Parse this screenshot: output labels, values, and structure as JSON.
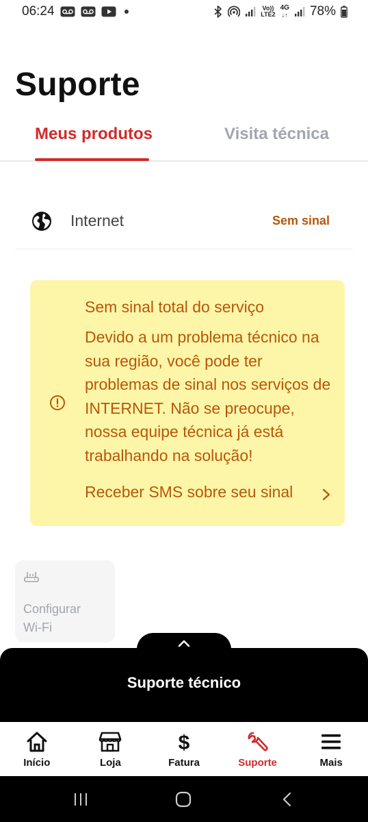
{
  "status_bar": {
    "time": "06:24",
    "battery": "78%",
    "network_vo": "Vo))",
    "network_lte": "LTE2",
    "network_4g": "4G"
  },
  "header": {
    "title": "Suporte"
  },
  "tabs": [
    {
      "label": "Meus produtos",
      "active": true
    },
    {
      "label": "Visita técnica",
      "active": false
    }
  ],
  "product": {
    "name": "Internet",
    "status": "Sem sinal"
  },
  "alert": {
    "title": "Sem sinal total do serviço",
    "message": "Devido a um problema técnico na sua região, você pode ter problemas de sinal nos serviços de INTERNET. Não se preocupe, nossa equipe técnica já está trabalhando na solução!",
    "link": "Receber SMS sobre seu sinal"
  },
  "wifi_tile": {
    "label": "Configurar\nWi-Fi"
  },
  "sheet": {
    "title": "Suporte técnico"
  },
  "bottom_nav": [
    {
      "label": "Início",
      "icon": "home-icon"
    },
    {
      "label": "Loja",
      "icon": "store-icon"
    },
    {
      "label": "Fatura",
      "icon": "dollar-icon"
    },
    {
      "label": "Suporte",
      "icon": "wrench-icon",
      "active": true
    },
    {
      "label": "Mais",
      "icon": "menu-icon"
    }
  ],
  "colors": {
    "accent": "#d12a2a",
    "warning_text": "#b8560a",
    "warning_bg": "#fdf6a8",
    "inactive": "#a2a6ad"
  }
}
